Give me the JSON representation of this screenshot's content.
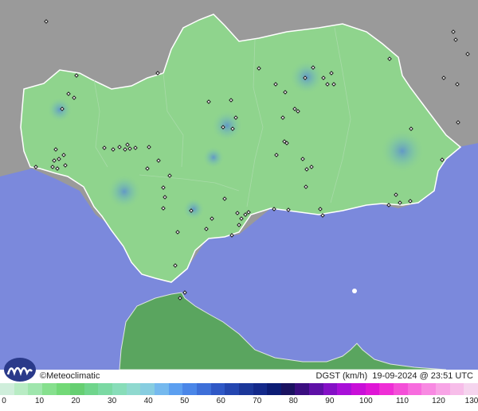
{
  "footer": {
    "brand": "©Meteoclimatic",
    "variable": "DGST (km/h)",
    "datetime": "19-09-2024 @ 23:51 UTC"
  },
  "legend": {
    "ticks": [
      "0",
      "10",
      "20",
      "30",
      "40",
      "50",
      "60",
      "70",
      "80",
      "90",
      "100",
      "110",
      "120",
      "130"
    ],
    "colors": [
      "#cfeedb",
      "#b8ecc4",
      "#9fe6ad",
      "#86e08e",
      "#72d977",
      "#66cf72",
      "#6fd58c",
      "#7bd9a3",
      "#88ddb9",
      "#8fd9cf",
      "#87cde0",
      "#75b9ee",
      "#5c9ff0",
      "#4a86e8",
      "#3d6fd8",
      "#2f58c6",
      "#2446b0",
      "#1b3799",
      "#13298a",
      "#0c1c74",
      "#1a1260",
      "#3a0e80",
      "#5e10a6",
      "#8410c6",
      "#a810d8",
      "#c80fd8",
      "#df16d6",
      "#ef2ed6",
      "#f44fd8",
      "#f76cde",
      "#f889e2",
      "#f8a4e6",
      "#f7bde9",
      "#f5d4ee"
    ],
    "colors_note": ""
  },
  "map_colors": {
    "sea": "#7b89dc",
    "land_outside": "#9a9a9a",
    "region_fill": "#8fd48d",
    "africa_fill": "#5aa55f",
    "boundary": "#ffffff"
  }
}
